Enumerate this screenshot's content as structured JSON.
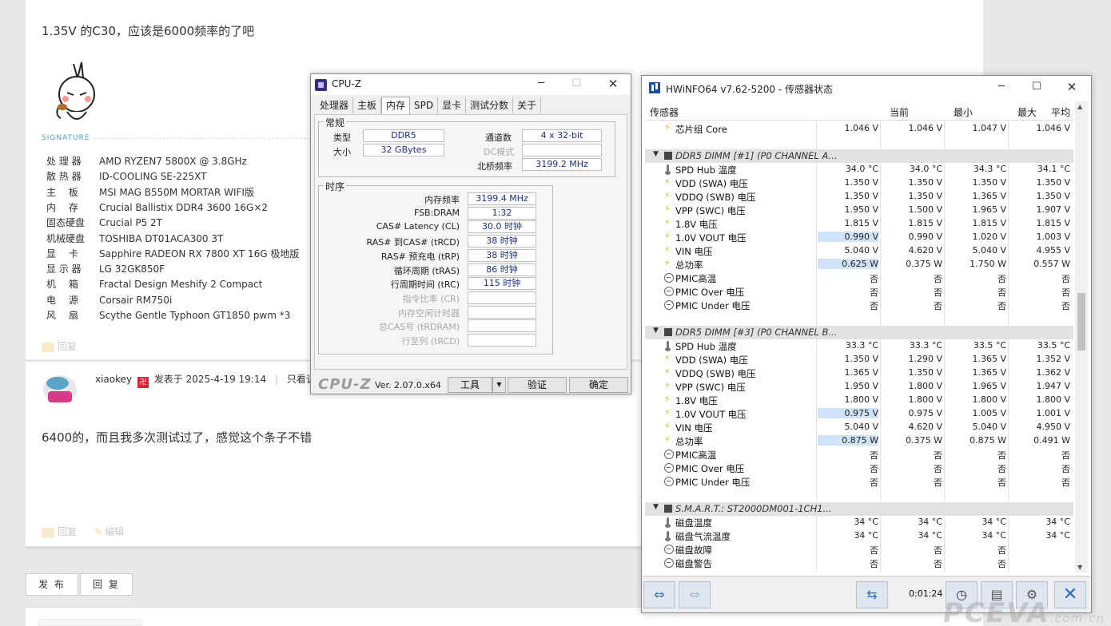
{
  "forum": {
    "post1_text": "1.35V 的C30，应该是6000频率的了吧",
    "signature_label": "SIGNATURE",
    "specs": [
      {
        "key": "处 理 器",
        "value": "AMD RYZEN7 5800X @ 3.8GHz"
      },
      {
        "key": "散 热 器",
        "value": "ID-COOLING SE-225XT"
      },
      {
        "key": "主　 板",
        "value": "MSI MAG B550M MORTAR WIFI版"
      },
      {
        "key": "内　 存",
        "value": "Crucial Ballistix DDR4 3600 16G×2"
      },
      {
        "key": "固态硬盘",
        "value": "Crucial P5 2T"
      },
      {
        "key": "机械硬盘",
        "value": "TOSHIBA DT01ACA300 3T"
      },
      {
        "key": "显　 卡",
        "value": "Sapphire RADEON RX 7800 XT 16G 极地版"
      },
      {
        "key": "显 示 器",
        "value": "LG 32GK850F"
      },
      {
        "key": "机　 箱",
        "value": "Fractal Design Meshify 2 Compact"
      },
      {
        "key": "电　 源",
        "value": "Corsair RM750i"
      },
      {
        "key": "风　 扇",
        "value": "Scythe Gentle Typhoon GT1850 pwm *3"
      }
    ],
    "reply_label": "回复",
    "edit_label": "编辑",
    "poster_name": "xiaokey",
    "poster_badge": "卍",
    "posted_at": "发表于 2025-4-19 19:14",
    "only_author": "只看该作者",
    "post2_text": "6400的，而且我多次测试过了，感觉这个条子不错",
    "publish_btn": "发 布",
    "reply_btn": "回 复"
  },
  "cpuz": {
    "title": "CPU-Z",
    "tabs": [
      "处理器",
      "主板",
      "内存",
      "SPD",
      "显卡",
      "测试分数",
      "关于"
    ],
    "active_tab": "内存",
    "general_title": "常规",
    "type_label": "类型",
    "type_value": "DDR5",
    "size_label": "大小",
    "size_value": "32 GBytes",
    "channels_label": "通道数",
    "channels_value": "4 x 32-bit",
    "dc_label": "DC模式",
    "nb_label": "北桥频率",
    "nb_value": "3199.2 MHz",
    "timing_title": "时序",
    "timings": [
      {
        "label": "内存频率",
        "value": "3199.4 MHz",
        "dim": false
      },
      {
        "label": "FSB:DRAM",
        "value": "1:32",
        "dim": false
      },
      {
        "label": "CAS# Latency (CL)",
        "value": "30.0 时钟",
        "dim": false
      },
      {
        "label": "RAS# 到CAS# (tRCD)",
        "value": "38 时钟",
        "dim": false
      },
      {
        "label": "RAS# 预充电 (tRP)",
        "value": "38 时钟",
        "dim": false
      },
      {
        "label": "循环周期 (tRAS)",
        "value": "86 时钟",
        "dim": false
      },
      {
        "label": "行周期时间 (tRC)",
        "value": "115 时钟",
        "dim": false
      },
      {
        "label": "指令比率 (CR)",
        "value": "",
        "dim": true
      },
      {
        "label": "内存空闲计时器",
        "value": "",
        "dim": true
      },
      {
        "label": "总CAS号 (tRDRAM)",
        "value": "",
        "dim": true
      },
      {
        "label": "行至列 (tRCD)",
        "value": "",
        "dim": true
      }
    ],
    "logo": "CPU-Z",
    "version": "Ver. 2.07.0.x64",
    "tools_btn": "工具",
    "validate_btn": "验证",
    "ok_btn": "确定"
  },
  "hwinfo": {
    "title": "HWiNFO64 v7.62-5200 - 传感器状态",
    "columns": [
      "传感器",
      "当前",
      "最小",
      "最大",
      "平均"
    ],
    "rows": [
      {
        "type": "sensor",
        "icon": "bolt",
        "name": "芯片组 Core",
        "cur": "1.046 V",
        "min": "1.046 V",
        "max": "1.047 V",
        "avg": "1.046 V"
      },
      {
        "type": "spacer"
      },
      {
        "type": "group",
        "name": "DDR5 DIMM [#1] (P0 CHANNEL A..."
      },
      {
        "type": "sensor",
        "icon": "therm",
        "name": "SPD Hub 温度",
        "cur": "34.0 °C",
        "min": "34.0 °C",
        "max": "34.3 °C",
        "avg": "34.1 °C"
      },
      {
        "type": "sensor",
        "icon": "bolt",
        "name": "VDD (SWA) 电压",
        "cur": "1.350 V",
        "min": "1.350 V",
        "max": "1.350 V",
        "avg": "1.350 V"
      },
      {
        "type": "sensor",
        "icon": "bolt",
        "name": "VDDQ (SWB) 电压",
        "cur": "1.350 V",
        "min": "1.350 V",
        "max": "1.365 V",
        "avg": "1.350 V"
      },
      {
        "type": "sensor",
        "icon": "bolt",
        "name": "VPP (SWC) 电压",
        "cur": "1.950 V",
        "min": "1.500 V",
        "max": "1.965 V",
        "avg": "1.907 V"
      },
      {
        "type": "sensor",
        "icon": "bolt",
        "name": "1.8V 电压",
        "cur": "1.815 V",
        "min": "1.815 V",
        "max": "1.815 V",
        "avg": "1.815 V"
      },
      {
        "type": "sensor",
        "icon": "bolt",
        "name": "1.0V VOUT 电压",
        "cur": "0.990 V",
        "min": "0.990 V",
        "max": "1.020 V",
        "avg": "1.003 V",
        "hl": true
      },
      {
        "type": "sensor",
        "icon": "bolt",
        "name": "VIN 电压",
        "cur": "5.040 V",
        "min": "4.620 V",
        "max": "5.040 V",
        "avg": "4.955 V"
      },
      {
        "type": "sensor",
        "icon": "bolt",
        "name": "总功率",
        "cur": "0.625 W",
        "min": "0.375 W",
        "max": "1.750 W",
        "avg": "0.557 W",
        "hl": true
      },
      {
        "type": "sensor",
        "icon": "circ",
        "name": "PMIC高温",
        "cur": "否",
        "min": "否",
        "max": "否",
        "avg": "否"
      },
      {
        "type": "sensor",
        "icon": "circ",
        "name": "PMIC Over 电压",
        "cur": "否",
        "min": "否",
        "max": "否",
        "avg": "否"
      },
      {
        "type": "sensor",
        "icon": "circ",
        "name": "PMIC Under 电压",
        "cur": "否",
        "min": "否",
        "max": "否",
        "avg": "否"
      },
      {
        "type": "spacer"
      },
      {
        "type": "group",
        "name": "DDR5 DIMM [#3] (P0 CHANNEL B..."
      },
      {
        "type": "sensor",
        "icon": "therm",
        "name": "SPD Hub 温度",
        "cur": "33.3 °C",
        "min": "33.3 °C",
        "max": "33.5 °C",
        "avg": "33.5 °C"
      },
      {
        "type": "sensor",
        "icon": "bolt",
        "name": "VDD (SWA) 电压",
        "cur": "1.350 V",
        "min": "1.290 V",
        "max": "1.365 V",
        "avg": "1.352 V"
      },
      {
        "type": "sensor",
        "icon": "bolt",
        "name": "VDDQ (SWB) 电压",
        "cur": "1.365 V",
        "min": "1.350 V",
        "max": "1.365 V",
        "avg": "1.362 V"
      },
      {
        "type": "sensor",
        "icon": "bolt",
        "name": "VPP (SWC) 电压",
        "cur": "1.950 V",
        "min": "1.800 V",
        "max": "1.965 V",
        "avg": "1.947 V"
      },
      {
        "type": "sensor",
        "icon": "bolt",
        "name": "1.8V 电压",
        "cur": "1.800 V",
        "min": "1.800 V",
        "max": "1.800 V",
        "avg": "1.800 V"
      },
      {
        "type": "sensor",
        "icon": "bolt",
        "name": "1.0V VOUT 电压",
        "cur": "0.975 V",
        "min": "0.975 V",
        "max": "1.005 V",
        "avg": "1.001 V",
        "hl": true
      },
      {
        "type": "sensor",
        "icon": "bolt",
        "name": "VIN 电压",
        "cur": "5.040 V",
        "min": "4.620 V",
        "max": "5.040 V",
        "avg": "4.950 V"
      },
      {
        "type": "sensor",
        "icon": "bolt",
        "name": "总功率",
        "cur": "0.875 W",
        "min": "0.375 W",
        "max": "0.875 W",
        "avg": "0.491 W",
        "hl": true
      },
      {
        "type": "sensor",
        "icon": "circ",
        "name": "PMIC高温",
        "cur": "否",
        "min": "否",
        "max": "否",
        "avg": "否"
      },
      {
        "type": "sensor",
        "icon": "circ",
        "name": "PMIC Over 电压",
        "cur": "否",
        "min": "否",
        "max": "否",
        "avg": "否"
      },
      {
        "type": "sensor",
        "icon": "circ",
        "name": "PMIC Under 电压",
        "cur": "否",
        "min": "否",
        "max": "否",
        "avg": "否"
      },
      {
        "type": "spacer"
      },
      {
        "type": "group",
        "name": "S.M.A.R.T.: ST2000DM001-1CH1..."
      },
      {
        "type": "sensor",
        "icon": "therm",
        "name": "磁盘温度",
        "cur": "34 °C",
        "min": "34 °C",
        "max": "34 °C",
        "avg": "34 °C"
      },
      {
        "type": "sensor",
        "icon": "therm",
        "name": "磁盘气流温度",
        "cur": "34 °C",
        "min": "34 °C",
        "max": "34 °C",
        "avg": "34 °C"
      },
      {
        "type": "sensor",
        "icon": "circ",
        "name": "磁盘故障",
        "cur": "否",
        "min": "否",
        "max": "否",
        "avg": ""
      },
      {
        "type": "sensor",
        "icon": "circ",
        "name": "磁盘警告",
        "cur": "否",
        "min": "否",
        "max": "否",
        "avg": ""
      }
    ],
    "timer": "0:01:24"
  },
  "watermark": {
    "brand": "PCEVA",
    "suffix": ".com.cn"
  },
  "icons": {
    "nav": "double-arrow-icon",
    "network": "network-icon",
    "clock": "clock-icon",
    "report": "report-icon",
    "settings": "settings-icon",
    "close": "close-icon"
  }
}
